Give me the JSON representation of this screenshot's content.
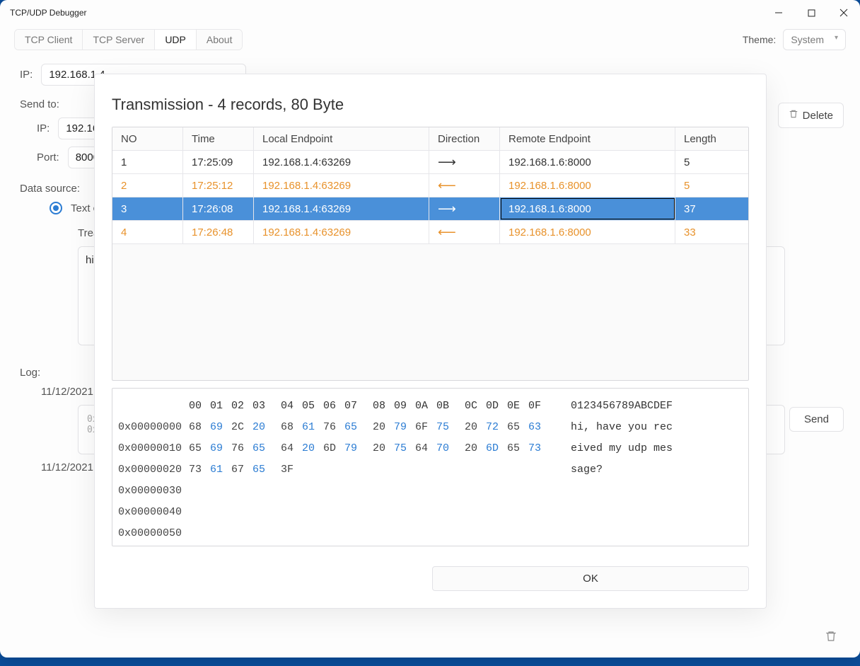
{
  "window": {
    "title": "TCP/UDP Debugger"
  },
  "tabs": [
    "TCP Client",
    "TCP Server",
    "UDP",
    "About"
  ],
  "activeTab": "UDP",
  "theme": {
    "label": "Theme:",
    "value": "System"
  },
  "bg": {
    "ip_label": "IP:",
    "ip_value": "192.168.1.4",
    "sendto_label": "Send to:",
    "sendto_ip_label": "IP:",
    "sendto_ip_value": "192.16",
    "port_label": "Port:",
    "port_value": "8000",
    "datasource_label": "Data source:",
    "textcontent_label": "Text co",
    "treat_label": "Trea",
    "message_value": "hi,",
    "log_label": "Log:",
    "log_date1": "11/12/2021",
    "log_hex1": "0x",
    "log_hex2": "0x",
    "log_date2": "11/12/2021",
    "send_button": "Send",
    "delete_button": "Delete"
  },
  "dialog": {
    "title": "Transmission - 4 records, 80 Byte",
    "headers": {
      "no": "NO",
      "time": "Time",
      "loc": "Local Endpoint",
      "dir": "Direction",
      "rem": "Remote Endpoint",
      "len": "Length"
    },
    "rows": [
      {
        "no": "1",
        "time": "17:25:09",
        "loc": "192.168.1.4:63269",
        "dir": "out",
        "rem": "192.168.1.6:8000",
        "len": "5",
        "sel": false,
        "in": false
      },
      {
        "no": "2",
        "time": "17:25:12",
        "loc": "192.168.1.4:63269",
        "dir": "in",
        "rem": "192.168.1.6:8000",
        "len": "5",
        "sel": false,
        "in": true
      },
      {
        "no": "3",
        "time": "17:26:08",
        "loc": "192.168.1.4:63269",
        "dir": "out",
        "rem": "192.168.1.6:8000",
        "len": "37",
        "sel": true,
        "in": false
      },
      {
        "no": "4",
        "time": "17:26:48",
        "loc": "192.168.1.4:63269",
        "dir": "in",
        "rem": "192.168.1.6:8000",
        "len": "33",
        "sel": false,
        "in": true
      }
    ],
    "hex": {
      "header_cols": [
        "00",
        "01",
        "02",
        "03",
        "04",
        "05",
        "06",
        "07",
        "08",
        "09",
        "0A",
        "0B",
        "0C",
        "0D",
        "0E",
        "0F"
      ],
      "header_ascii": "0123456789ABCDEF",
      "rows": [
        {
          "off": "0x00000000",
          "b": [
            "68",
            "69",
            "2C",
            "20",
            "68",
            "61",
            "76",
            "65",
            "20",
            "79",
            "6F",
            "75",
            "20",
            "72",
            "65",
            "63"
          ],
          "txt": "hi, have you rec"
        },
        {
          "off": "0x00000010",
          "b": [
            "65",
            "69",
            "76",
            "65",
            "64",
            "20",
            "6D",
            "79",
            "20",
            "75",
            "64",
            "70",
            "20",
            "6D",
            "65",
            "73"
          ],
          "txt": "eived my udp mes"
        },
        {
          "off": "0x00000020",
          "b": [
            "73",
            "61",
            "67",
            "65",
            "3F"
          ],
          "txt": "sage?"
        },
        {
          "off": "0x00000030",
          "b": [],
          "txt": ""
        },
        {
          "off": "0x00000040",
          "b": [],
          "txt": ""
        },
        {
          "off": "0x00000050",
          "b": [],
          "txt": ""
        }
      ]
    },
    "ok": "OK"
  }
}
